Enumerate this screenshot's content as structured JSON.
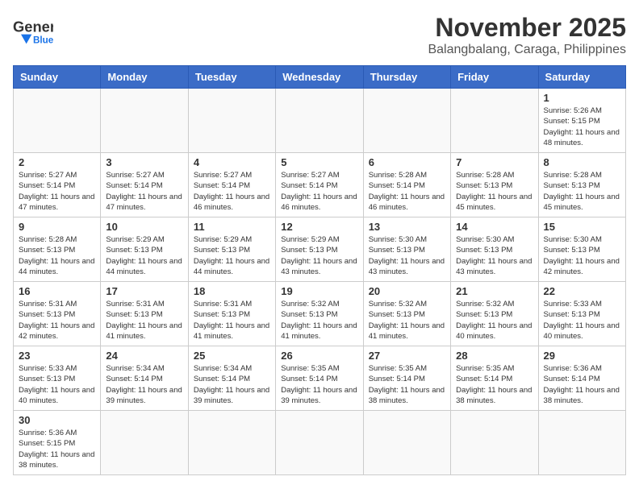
{
  "header": {
    "logo_general": "General",
    "logo_blue": "Blue",
    "month_title": "November 2025",
    "location": "Balangbalang, Caraga, Philippines"
  },
  "weekdays": [
    "Sunday",
    "Monday",
    "Tuesday",
    "Wednesday",
    "Thursday",
    "Friday",
    "Saturday"
  ],
  "weeks": [
    [
      {
        "day": "",
        "info": ""
      },
      {
        "day": "",
        "info": ""
      },
      {
        "day": "",
        "info": ""
      },
      {
        "day": "",
        "info": ""
      },
      {
        "day": "",
        "info": ""
      },
      {
        "day": "",
        "info": ""
      },
      {
        "day": "1",
        "info": "Sunrise: 5:26 AM\nSunset: 5:15 PM\nDaylight: 11 hours\nand 48 minutes."
      }
    ],
    [
      {
        "day": "2",
        "info": "Sunrise: 5:27 AM\nSunset: 5:14 PM\nDaylight: 11 hours\nand 47 minutes."
      },
      {
        "day": "3",
        "info": "Sunrise: 5:27 AM\nSunset: 5:14 PM\nDaylight: 11 hours\nand 47 minutes."
      },
      {
        "day": "4",
        "info": "Sunrise: 5:27 AM\nSunset: 5:14 PM\nDaylight: 11 hours\nand 46 minutes."
      },
      {
        "day": "5",
        "info": "Sunrise: 5:27 AM\nSunset: 5:14 PM\nDaylight: 11 hours\nand 46 minutes."
      },
      {
        "day": "6",
        "info": "Sunrise: 5:28 AM\nSunset: 5:14 PM\nDaylight: 11 hours\nand 46 minutes."
      },
      {
        "day": "7",
        "info": "Sunrise: 5:28 AM\nSunset: 5:13 PM\nDaylight: 11 hours\nand 45 minutes."
      },
      {
        "day": "8",
        "info": "Sunrise: 5:28 AM\nSunset: 5:13 PM\nDaylight: 11 hours\nand 45 minutes."
      }
    ],
    [
      {
        "day": "9",
        "info": "Sunrise: 5:28 AM\nSunset: 5:13 PM\nDaylight: 11 hours\nand 44 minutes."
      },
      {
        "day": "10",
        "info": "Sunrise: 5:29 AM\nSunset: 5:13 PM\nDaylight: 11 hours\nand 44 minutes."
      },
      {
        "day": "11",
        "info": "Sunrise: 5:29 AM\nSunset: 5:13 PM\nDaylight: 11 hours\nand 44 minutes."
      },
      {
        "day": "12",
        "info": "Sunrise: 5:29 AM\nSunset: 5:13 PM\nDaylight: 11 hours\nand 43 minutes."
      },
      {
        "day": "13",
        "info": "Sunrise: 5:30 AM\nSunset: 5:13 PM\nDaylight: 11 hours\nand 43 minutes."
      },
      {
        "day": "14",
        "info": "Sunrise: 5:30 AM\nSunset: 5:13 PM\nDaylight: 11 hours\nand 43 minutes."
      },
      {
        "day": "15",
        "info": "Sunrise: 5:30 AM\nSunset: 5:13 PM\nDaylight: 11 hours\nand 42 minutes."
      }
    ],
    [
      {
        "day": "16",
        "info": "Sunrise: 5:31 AM\nSunset: 5:13 PM\nDaylight: 11 hours\nand 42 minutes."
      },
      {
        "day": "17",
        "info": "Sunrise: 5:31 AM\nSunset: 5:13 PM\nDaylight: 11 hours\nand 41 minutes."
      },
      {
        "day": "18",
        "info": "Sunrise: 5:31 AM\nSunset: 5:13 PM\nDaylight: 11 hours\nand 41 minutes."
      },
      {
        "day": "19",
        "info": "Sunrise: 5:32 AM\nSunset: 5:13 PM\nDaylight: 11 hours\nand 41 minutes."
      },
      {
        "day": "20",
        "info": "Sunrise: 5:32 AM\nSunset: 5:13 PM\nDaylight: 11 hours\nand 41 minutes."
      },
      {
        "day": "21",
        "info": "Sunrise: 5:32 AM\nSunset: 5:13 PM\nDaylight: 11 hours\nand 40 minutes."
      },
      {
        "day": "22",
        "info": "Sunrise: 5:33 AM\nSunset: 5:13 PM\nDaylight: 11 hours\nand 40 minutes."
      }
    ],
    [
      {
        "day": "23",
        "info": "Sunrise: 5:33 AM\nSunset: 5:13 PM\nDaylight: 11 hours\nand 40 minutes."
      },
      {
        "day": "24",
        "info": "Sunrise: 5:34 AM\nSunset: 5:14 PM\nDaylight: 11 hours\nand 39 minutes."
      },
      {
        "day": "25",
        "info": "Sunrise: 5:34 AM\nSunset: 5:14 PM\nDaylight: 11 hours\nand 39 minutes."
      },
      {
        "day": "26",
        "info": "Sunrise: 5:35 AM\nSunset: 5:14 PM\nDaylight: 11 hours\nand 39 minutes."
      },
      {
        "day": "27",
        "info": "Sunrise: 5:35 AM\nSunset: 5:14 PM\nDaylight: 11 hours\nand 38 minutes."
      },
      {
        "day": "28",
        "info": "Sunrise: 5:35 AM\nSunset: 5:14 PM\nDaylight: 11 hours\nand 38 minutes."
      },
      {
        "day": "29",
        "info": "Sunrise: 5:36 AM\nSunset: 5:14 PM\nDaylight: 11 hours\nand 38 minutes."
      }
    ],
    [
      {
        "day": "30",
        "info": "Sunrise: 5:36 AM\nSunset: 5:15 PM\nDaylight: 11 hours\nand 38 minutes."
      },
      {
        "day": "",
        "info": ""
      },
      {
        "day": "",
        "info": ""
      },
      {
        "day": "",
        "info": ""
      },
      {
        "day": "",
        "info": ""
      },
      {
        "day": "",
        "info": ""
      },
      {
        "day": "",
        "info": ""
      }
    ]
  ]
}
